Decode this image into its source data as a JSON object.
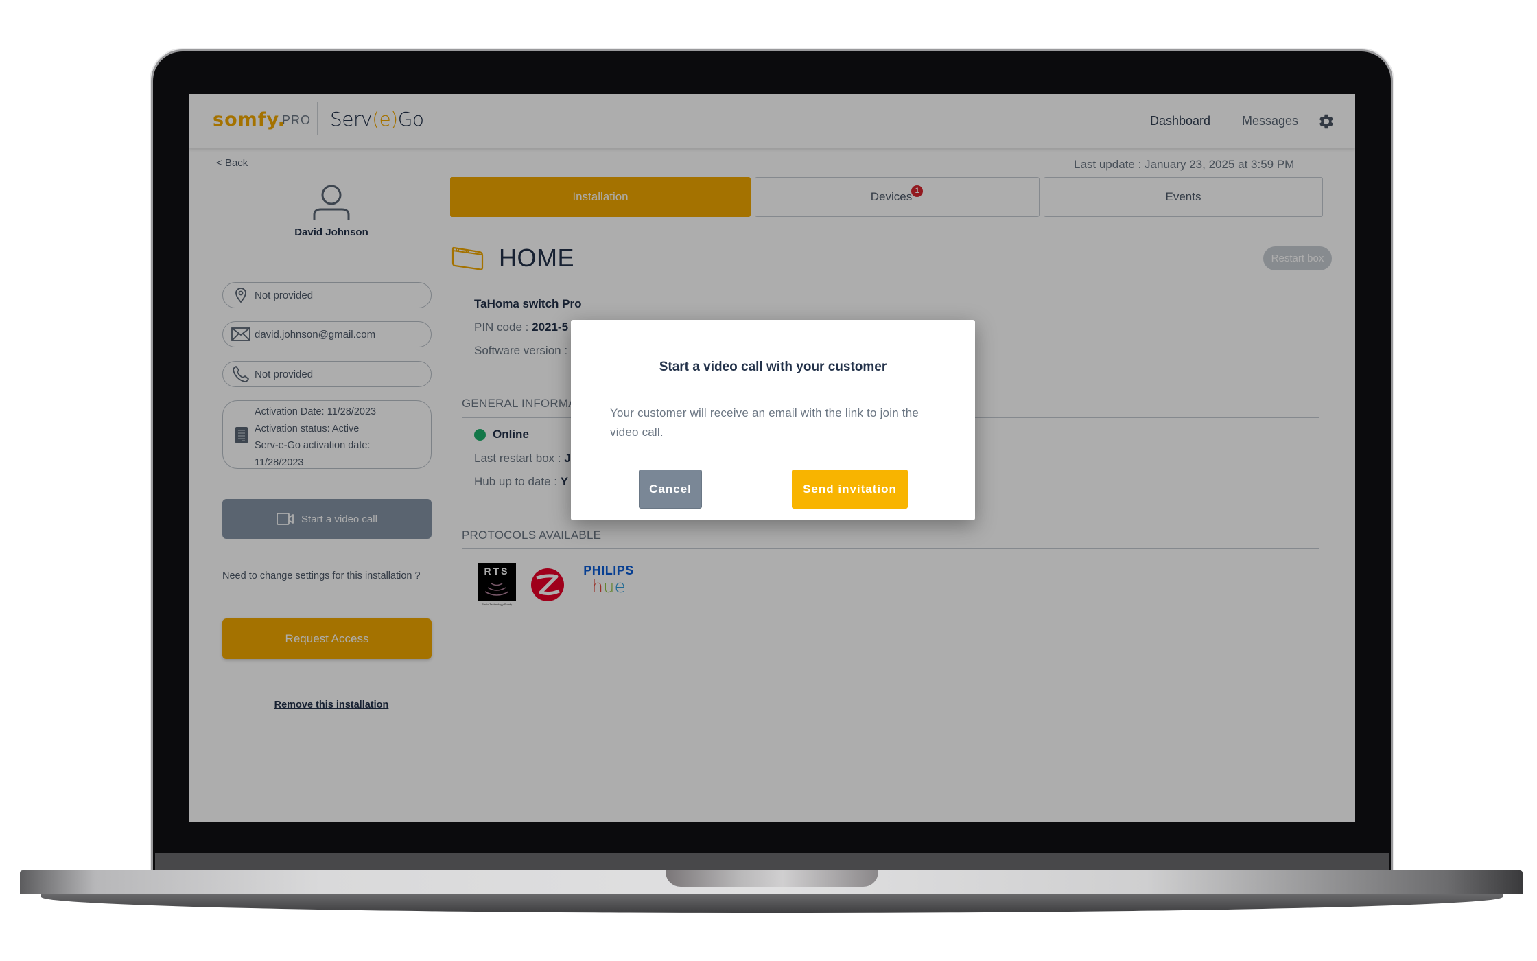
{
  "header": {
    "brand": "somfy.",
    "brand_suffix": "PRO",
    "product_prefix": "Serv",
    "product_e": "e",
    "product_suffix": "Go",
    "nav": [
      {
        "label": "Dashboard"
      },
      {
        "label": "Messages"
      }
    ],
    "settings_icon": "gear-icon"
  },
  "back": {
    "arrow": "<",
    "label": "Back"
  },
  "last_update": "Last update : January 23, 2025 at 3:59 PM",
  "customer": {
    "name": "David Johnson",
    "location": "Not provided",
    "email": "david.johnson@gmail.com",
    "phone": "Not provided",
    "activation": [
      "Activation Date: 11/28/2023",
      "Activation status: Active",
      "Serv-e-Go activation date:",
      "11/28/2023"
    ]
  },
  "sidebar": {
    "video_call_label": "Start a video call",
    "change_settings_text": "Need to change settings for this installation ?",
    "request_access_label": "Request Access",
    "remove_label": "Remove this installation"
  },
  "tabs": [
    {
      "label": "Installation",
      "active": true
    },
    {
      "label": "Devices",
      "badge": "1"
    },
    {
      "label": "Events"
    }
  ],
  "installation": {
    "title": "HOME",
    "restart_label": "Restart box",
    "device_name": "TaHoma switch Pro",
    "pin_label": "PIN code : ",
    "pin_value": "2021-5",
    "software_label": "Software version : ",
    "general_title": "GENERAL INFORMATION",
    "status": "Online",
    "status_color": "#1bb06a",
    "last_restart_label": "Last restart box : ",
    "last_restart_value": "J",
    "hub_label": "Hub up to date : ",
    "hub_value": "Y",
    "protocols_title": "PROTOCOLS AVAILABLE",
    "protocols": [
      {
        "name": "RTS",
        "caption": "Radio Technology Somfy"
      },
      {
        "name": "Zigbee"
      },
      {
        "name": "PHILIPS",
        "sub": "hue"
      }
    ]
  },
  "modal": {
    "title": "Start a video call with your customer",
    "body": "Your customer will receive an email with the link to join the video call.",
    "cancel_label": "Cancel",
    "send_label": "Send invitation"
  },
  "colors": {
    "accent": "#f2a900",
    "primary_text": "#23324a",
    "badge": "#d8262f"
  }
}
